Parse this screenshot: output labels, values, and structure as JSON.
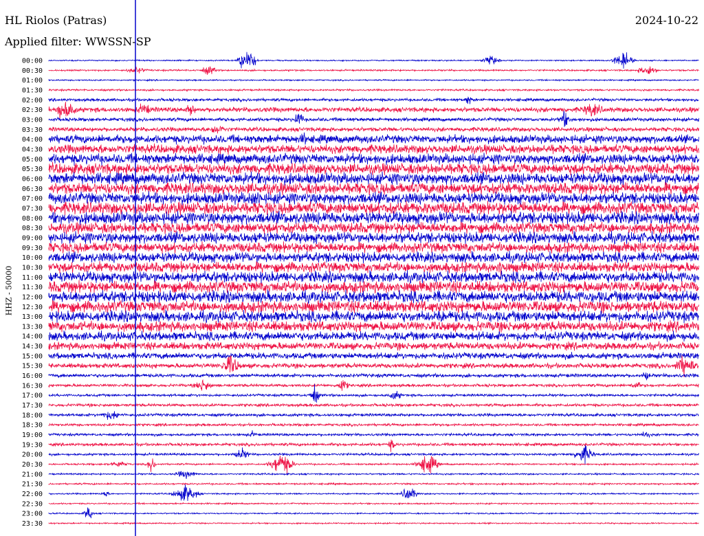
{
  "header": {
    "station": "HL Riolos (Patras)",
    "filter": "Applied filter: WWSSN-SP",
    "date": "2024-10-22"
  },
  "chart_data": {
    "type": "line",
    "title": "HL Riolos (Patras)",
    "subtitle": "Applied filter: WWSSN-SP",
    "ylabel": "HHZ - 50000",
    "xlabel": "",
    "row_labels": [
      "00:00",
      "00:30",
      "01:00",
      "01:30",
      "02:00",
      "02:30",
      "03:00",
      "03:30",
      "04:00",
      "04:30",
      "05:00",
      "05:30",
      "06:00",
      "06:30",
      "07:00",
      "07:30",
      "08:00",
      "08:30",
      "09:00",
      "09:30",
      "10:00",
      "10:30",
      "11:00",
      "11:30",
      "12:00",
      "12:30",
      "13:00",
      "13:30",
      "14:00",
      "14:30",
      "15:00",
      "15:30",
      "16:00",
      "16:30",
      "17:00",
      "17:30",
      "18:00",
      "18:30",
      "19:00",
      "19:30",
      "20:00",
      "20:30",
      "21:00",
      "21:30",
      "22:00",
      "22:30",
      "23:00",
      "23:30"
    ],
    "row_colors": [
      "#0000cc",
      "#ee1144"
    ],
    "activity_level": [
      0.02,
      0.05,
      0.03,
      0.06,
      0.15,
      0.3,
      0.2,
      0.25,
      0.55,
      0.6,
      0.7,
      0.75,
      0.8,
      0.8,
      0.8,
      0.85,
      0.85,
      0.75,
      0.75,
      0.7,
      0.7,
      0.7,
      0.75,
      0.8,
      0.8,
      0.8,
      0.75,
      0.7,
      0.6,
      0.5,
      0.4,
      0.3,
      0.2,
      0.15,
      0.12,
      0.15,
      0.15,
      0.12,
      0.12,
      0.15,
      0.1,
      0.06,
      0.05,
      0.06,
      0.04,
      0.04,
      0.03,
      0.03
    ],
    "current_time_marker": "19:04",
    "grid": false
  }
}
